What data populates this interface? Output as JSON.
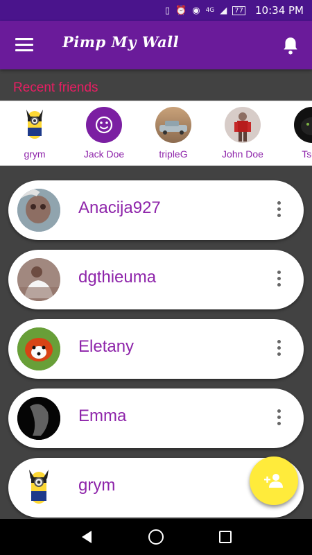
{
  "status_bar": {
    "time": "10:34 PM",
    "network": "4G",
    "battery": "77",
    "icons": [
      "vibrate-icon",
      "alarm-icon",
      "eye-icon",
      "signal-icon",
      "battery-icon"
    ]
  },
  "app_bar": {
    "title": "Pimp My Wall",
    "menu_icon": "hamburger-menu-icon",
    "notification_icon": "bell-icon",
    "color": "#6a1b9a"
  },
  "recent": {
    "label": "Recent friends",
    "label_color": "#e91e63",
    "items": [
      {
        "name": "grym",
        "avatar": "minion-wolverine-avatar"
      },
      {
        "name": "Jack Doe",
        "avatar": "smiley-default-avatar"
      },
      {
        "name": "tripleG",
        "avatar": "car-photo-avatar"
      },
      {
        "name": "John Doe",
        "avatar": "robot-figure-avatar"
      },
      {
        "name": "Tsou",
        "avatar": "black-panther-avatar"
      }
    ]
  },
  "friends": [
    {
      "name": "Anacija927",
      "avatar": "alien-avatar"
    },
    {
      "name": "dgthieuma",
      "avatar": "man-on-couch-avatar"
    },
    {
      "name": "Eletany",
      "avatar": "red-panda-avatar"
    },
    {
      "name": "Emma",
      "avatar": "dark-figure-avatar"
    },
    {
      "name": "grym",
      "avatar": "minion-wolverine-avatar"
    }
  ],
  "fab": {
    "icon": "add-friend-icon",
    "color": "#ffeb3b"
  },
  "nav": {
    "icons": [
      "back-icon",
      "home-icon",
      "recents-icon"
    ]
  },
  "colors": {
    "name_text": "#8e24aa",
    "background": "#424242"
  }
}
